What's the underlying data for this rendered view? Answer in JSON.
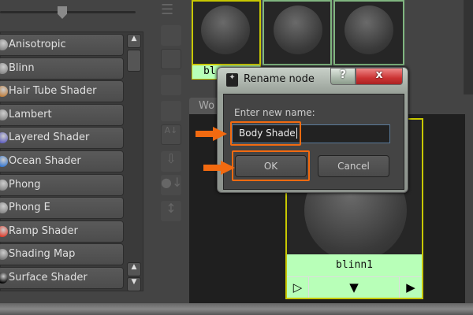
{
  "shader_list": [
    {
      "label": "Anisotropic",
      "color": "#888"
    },
    {
      "label": "Blinn",
      "color": "#888"
    },
    {
      "label": "Hair Tube Shader",
      "color": "#c08040"
    },
    {
      "label": "Lambert",
      "color": "#888"
    },
    {
      "label": "Layered Shader",
      "color": "#6060c0"
    },
    {
      "label": "Ocean Shader",
      "color": "#3a7ad0"
    },
    {
      "label": "Phong",
      "color": "#888"
    },
    {
      "label": "Phong E",
      "color": "#888"
    },
    {
      "label": "Ramp Shader",
      "color": "#e04030"
    },
    {
      "label": "Shading Map",
      "color": "#777"
    },
    {
      "label": "Surface Shader",
      "color": "#000"
    }
  ],
  "swatch_label_partial": "bl",
  "work_tab": "Wo",
  "node": {
    "name": "blinn1",
    "left_arrow": "▷",
    "down_arrow": "▼",
    "right_arrow": "▶"
  },
  "dialog": {
    "title": "Rename node",
    "help": "?",
    "close": "x",
    "prompt": "Enter new name:",
    "input_value": "Body Shade",
    "ok": "OK",
    "cancel": "Cancel"
  },
  "colors": {
    "highlight": "#f26a10",
    "node_label": "#b8ffb8",
    "node_border": "#c8c800"
  }
}
